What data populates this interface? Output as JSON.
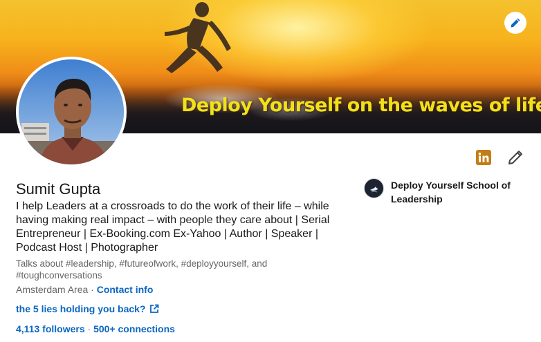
{
  "profile": {
    "name": "Sumit Gupta",
    "headline": "I help Leaders at a crossroads to do the work of their life – while having making real impact – with people they care about | Serial Entrepreneur | Ex-Booking.com Ex-Yahoo | Author | Speaker | Podcast Host | Photographer",
    "talks_about": "Talks about #leadership, #futureofwork, #deployyourself, and #toughconversations",
    "location": "Amsterdam Area",
    "location_separator": "·",
    "contact_info_label": "Contact info",
    "website_label": "the 5 lies holding you back?",
    "followers_label": "4,113 followers",
    "counts_separator": "·",
    "connections_label": "500+ connections"
  },
  "banner": {
    "tagline": "Deploy Yourself on the waves of life"
  },
  "company": {
    "name": "Deploy Yourself School of Leadership"
  },
  "icons": {
    "edit_cover": "pencil-icon",
    "linkedin_badge": "linkedin-icon",
    "edit_intro": "pencil-icon",
    "external_link": "external-link-icon"
  },
  "colors": {
    "link": "#0a66c2",
    "text_primary": "#191919",
    "text_secondary": "#666666",
    "linkedin_badge": "#c37d16"
  }
}
